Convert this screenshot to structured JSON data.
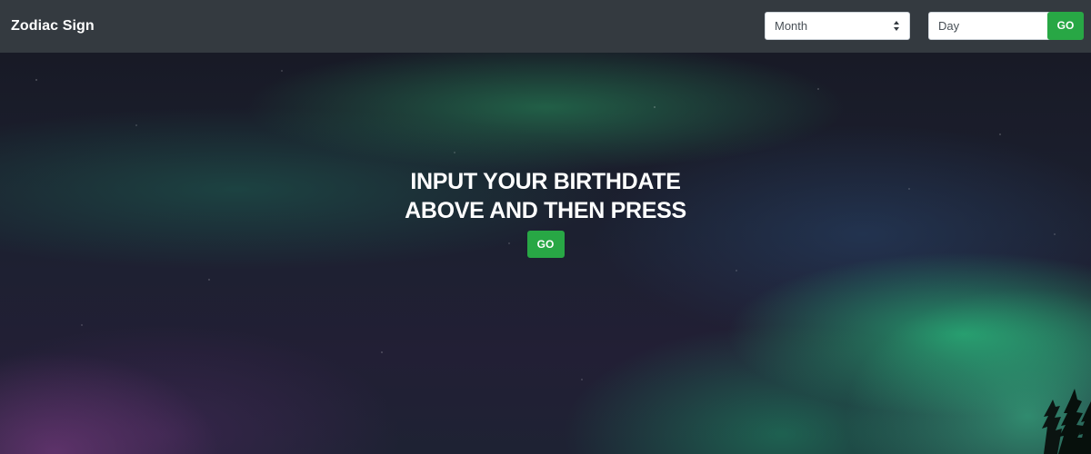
{
  "navbar": {
    "brand": "Zodiac Sign",
    "month_select": {
      "value": "Month",
      "icon": "select-caret-icon"
    },
    "day_select": {
      "value": "Day",
      "icon": "select-caret-icon"
    },
    "go_label": "GO"
  },
  "hero": {
    "title": "INPUT YOUR BIRTHDATE ABOVE AND THEN PRESS",
    "go_label": "GO",
    "background": "aurora-night-sky-image"
  },
  "colors": {
    "navbar_bg": "#343a40",
    "go_button": "#28a745",
    "text": "#ffffff"
  }
}
